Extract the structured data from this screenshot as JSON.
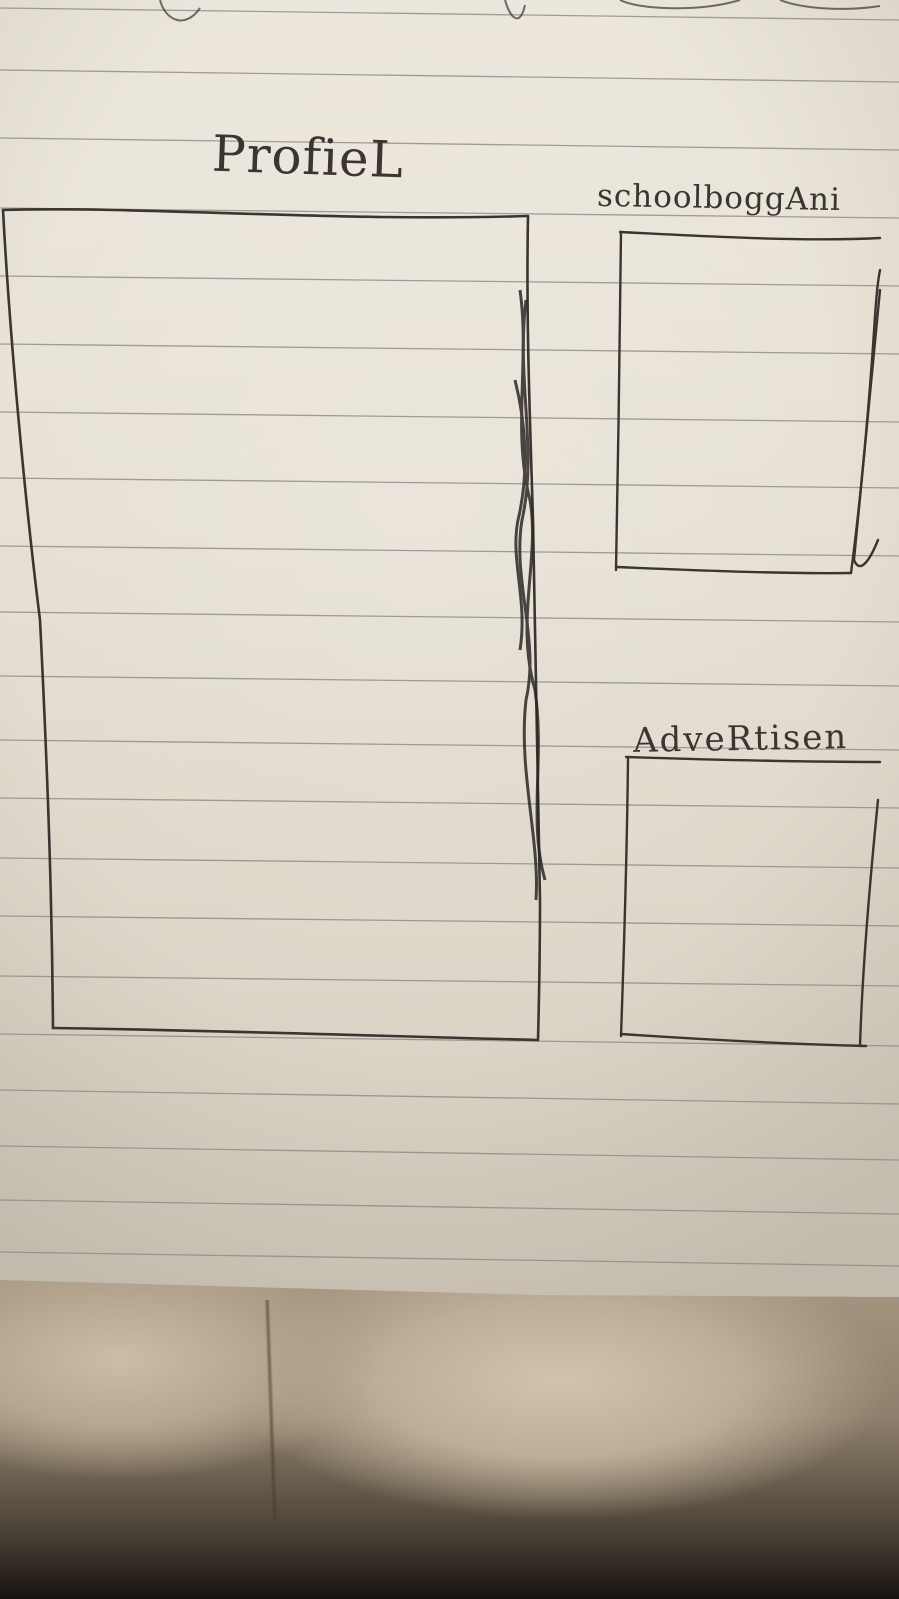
{
  "sketch": {
    "medium": "pencil sketch on lined notebook paper",
    "colors": {
      "paper": "#e9e4d9",
      "rule_line": "#8c8a86",
      "pencil": "#3a3530",
      "blanket": "#bfae97"
    },
    "panels": {
      "profile": {
        "label": "ProfieL"
      },
      "school": {
        "label": "schoolboggAni"
      },
      "ad": {
        "label": "AdveRtisen"
      }
    }
  }
}
